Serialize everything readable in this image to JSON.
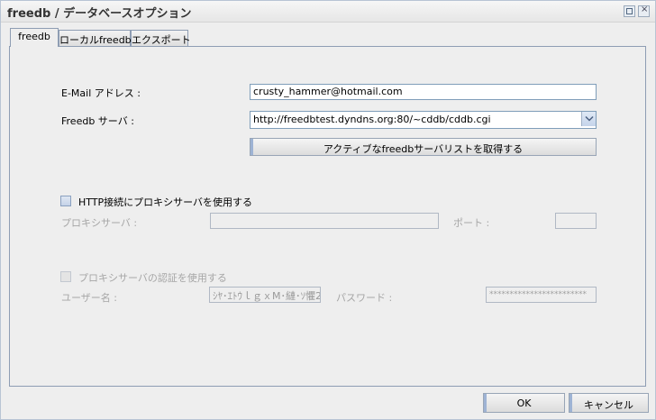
{
  "window": {
    "title": "freedb / データベースオプション"
  },
  "tabs": [
    {
      "label": "freedb"
    },
    {
      "label": "ローカルfreedb"
    },
    {
      "label": "エクスポート"
    }
  ],
  "form": {
    "email_label": "E-Mail アドレス :",
    "email_value": "crusty_hammer@hotmail.com",
    "server_label": "Freedb サーバ :",
    "server_value": "http://freedbtest.dyndns.org:80/~cddb/cddb.cgi",
    "fetch_button": "アクティブなfreedbサーバリストを取得する",
    "proxy_checkbox": "HTTP接続にプロキシサーバを使用する",
    "proxy_server_label": "プロキシサーバ :",
    "proxy_server_value": "",
    "port_label": "ポート :",
    "port_value": "",
    "proxy_auth_checkbox": "プロキシサーバの認証を使用する",
    "username_label": "ユーザー名 :",
    "username_value": "ｼﾔ･ｴﾄｳｌｇｘM･縺･ｿ懼2",
    "password_label": "パスワード :",
    "password_value": "************************"
  },
  "footer": {
    "ok": "OK",
    "cancel": "キャンセル"
  }
}
